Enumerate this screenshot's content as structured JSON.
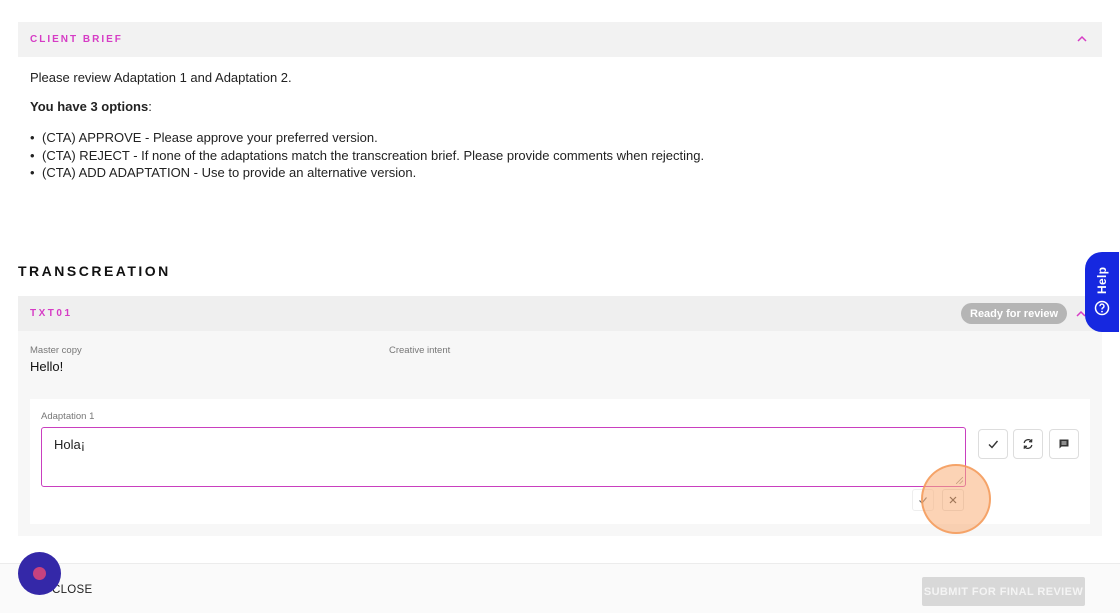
{
  "brief": {
    "title": "CLIENT BRIEF",
    "intro": "Please review Adaptation 1 and Adaptation 2.",
    "options_heading": "You have 3 options",
    "options_colon": ":",
    "options": [
      "(CTA) APPROVE - Please approve your preferred version.",
      "(CTA) REJECT - If none of the adaptations match the transcreation brief. Please provide comments when rejecting.",
      "(CTA) ADD ADAPTATION - Use to provide an alternative version."
    ]
  },
  "transcreation": {
    "section_title": "TRANSCREATION",
    "item": {
      "id": "TXT01",
      "status": "Ready for review",
      "master_copy_label": "Master copy",
      "master_copy_value": "Hello!",
      "creative_intent_label": "Creative intent",
      "creative_intent_value": "",
      "adaptation_label": "Adaptation 1",
      "adaptation_value": "Hola¡"
    }
  },
  "footer": {
    "close_label": "CLOSE",
    "submit_label": "SUBMIT FOR FINAL REVIEW"
  },
  "help": {
    "label": "Help"
  },
  "colors": {
    "accent_pink": "#d63cc5",
    "help_blue": "#1628e0",
    "chat_purple": "#3428a8",
    "badge_gray": "#b5b5b5"
  },
  "icons": [
    "chevron-up-icon",
    "check-icon",
    "refresh-icon",
    "comment-icon",
    "close-icon",
    "help-circle-icon",
    "chat-icon"
  ]
}
